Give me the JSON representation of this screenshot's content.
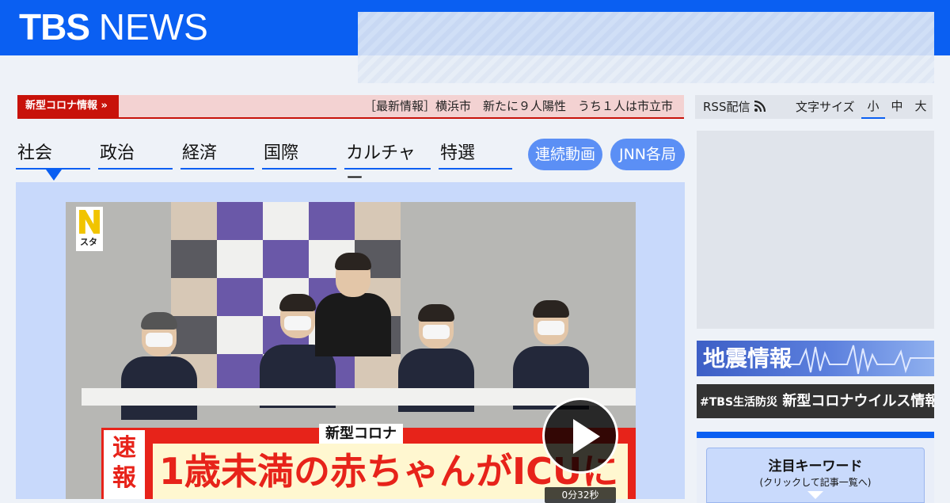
{
  "header": {
    "logo_tbs": "TBS",
    "logo_news": "NEWS"
  },
  "ticker": {
    "label": "新型コロナ情報 »",
    "headline": "［最新情報］横浜市　新たに９人陽性　うち１人は市立市"
  },
  "toolbar": {
    "rss_label": "RSS配信",
    "font_size_label": "文字サイズ",
    "font_sizes": [
      "小",
      "中",
      "大"
    ],
    "selected_font_size": "小"
  },
  "nav": {
    "categories": [
      "社会",
      "政治",
      "経済",
      "国際",
      "カルチャー",
      "特選"
    ],
    "active_category": "社会",
    "pills": [
      "連続動画",
      "JNN各局"
    ]
  },
  "video": {
    "brand_mark": "スタ",
    "caption_top": "新型コロナ",
    "caption_flash": "速報",
    "caption_main": "1歳未満の赤ちゃんがICUに",
    "duration": "0分32秒"
  },
  "sidebar": {
    "quake_banner": "地震情報",
    "corona_banner_tag": "#TBS生活防災",
    "corona_banner": "新型コロナウイルス情報",
    "keywords_title": "注目キーワード",
    "keywords_sub": "(クリックして記事一覧へ)"
  },
  "colors": {
    "brand_blue": "#0a5ff2",
    "alert_red": "#c8120a",
    "pill_blue": "#5b8ff5"
  }
}
